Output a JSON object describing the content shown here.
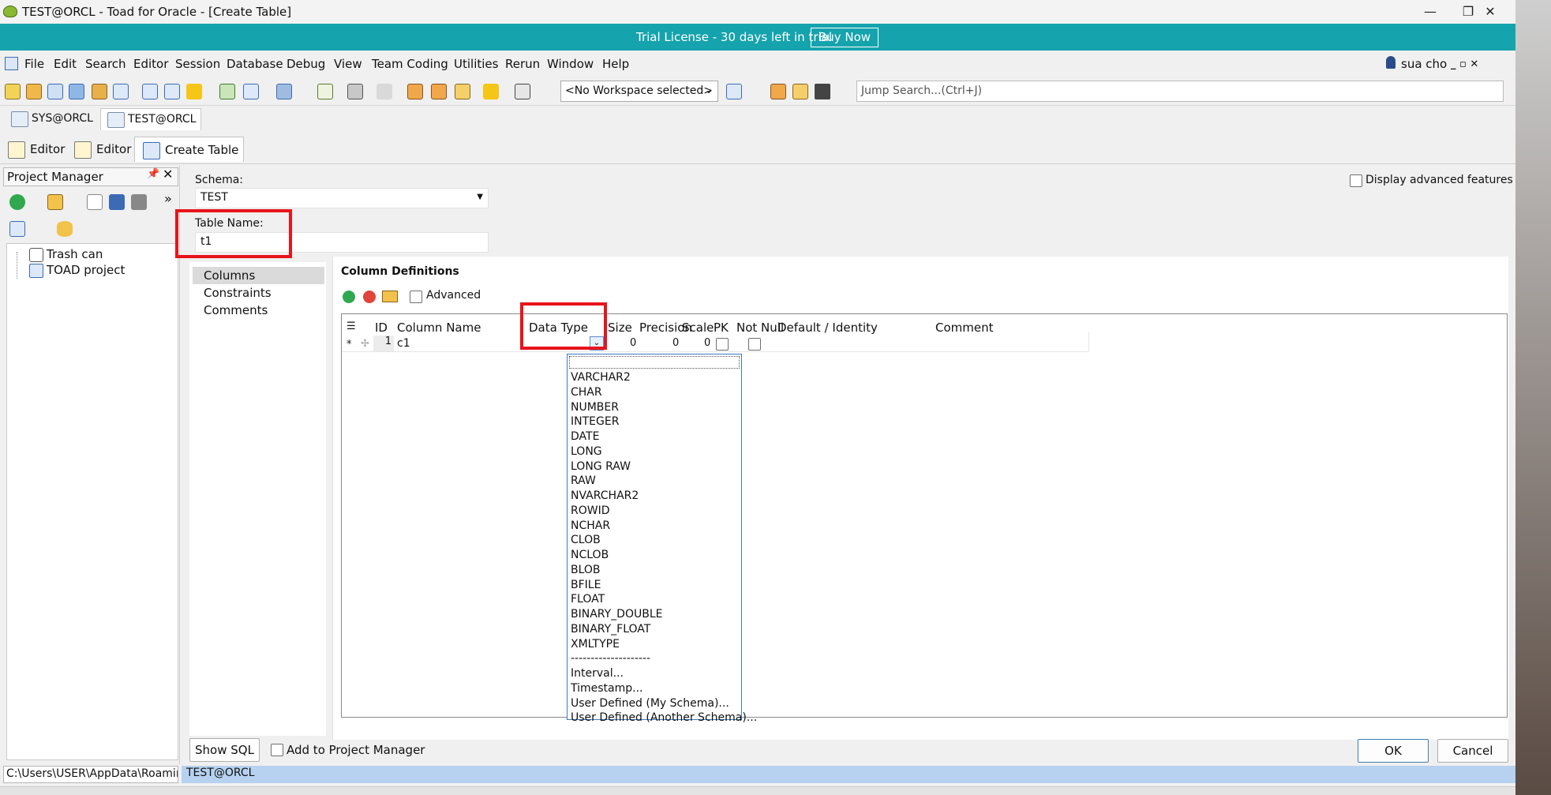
{
  "window": {
    "title": "TEST@ORCL - Toad for Oracle - [Create Table]",
    "controls": [
      "—",
      "❐",
      "✕"
    ]
  },
  "trial": {
    "message": "Trial License - 30 days left in trial",
    "buy_label": "Buy Now",
    "color": "#15a3ad"
  },
  "menu": {
    "items": [
      "File",
      "Edit",
      "Search",
      "Editor",
      "Session",
      "Database",
      "Debug",
      "View",
      "Team Coding",
      "Utilities",
      "Rerun",
      "Window",
      "Help"
    ],
    "user": "sua cho"
  },
  "toolbar": {
    "workspace": "<No Workspace selected>",
    "jump_placeholder": "Jump Search...(Ctrl+J)"
  },
  "connections": [
    "SYS@ORCL",
    "TEST@ORCL"
  ],
  "doc_tabs": [
    "Editor",
    "Editor",
    "Create Table"
  ],
  "project_manager": {
    "title": "Project Manager",
    "tree": [
      "Trash can",
      "TOAD project"
    ]
  },
  "form": {
    "schema_label": "Schema:",
    "schema_value": "TEST",
    "table_name_label": "Table Name:",
    "table_name_value": "t1",
    "advanced_features_label": "Display advanced features"
  },
  "nav": [
    "Columns",
    "Constraints",
    "Comments"
  ],
  "columns_panel": {
    "title": "Column Definitions",
    "advanced_label": "Advanced",
    "headers": [
      "ID",
      "Column Name",
      "Data Type",
      "Size",
      "Precision",
      "Scale",
      "PK",
      "Not Null",
      "Default / Identity",
      "Comment"
    ],
    "row": {
      "marker": "*",
      "id": "1",
      "name": "c1",
      "size": "0",
      "precision": "0",
      "scale": "0"
    }
  },
  "datatype_options": [
    "VARCHAR2",
    "CHAR",
    "NUMBER",
    "INTEGER",
    "DATE",
    "LONG",
    "LONG RAW",
    "RAW",
    "NVARCHAR2",
    "ROWID",
    "NCHAR",
    "CLOB",
    "NCLOB",
    "BLOB",
    "BFILE",
    "FLOAT",
    "BINARY_DOUBLE",
    "BINARY_FLOAT",
    "XMLTYPE",
    "--------------------",
    "Interval...",
    "Timestamp...",
    "User Defined (My Schema)...",
    "User Defined (Another Schema)..."
  ],
  "bottom": {
    "show_sql": "Show SQL",
    "add_to_pm": "Add to Project Manager",
    "ok": "OK",
    "cancel": "Cancel"
  },
  "status": {
    "path": "C:\\Users\\USER\\AppData\\Roaming",
    "connection": "TEST@ORCL"
  }
}
